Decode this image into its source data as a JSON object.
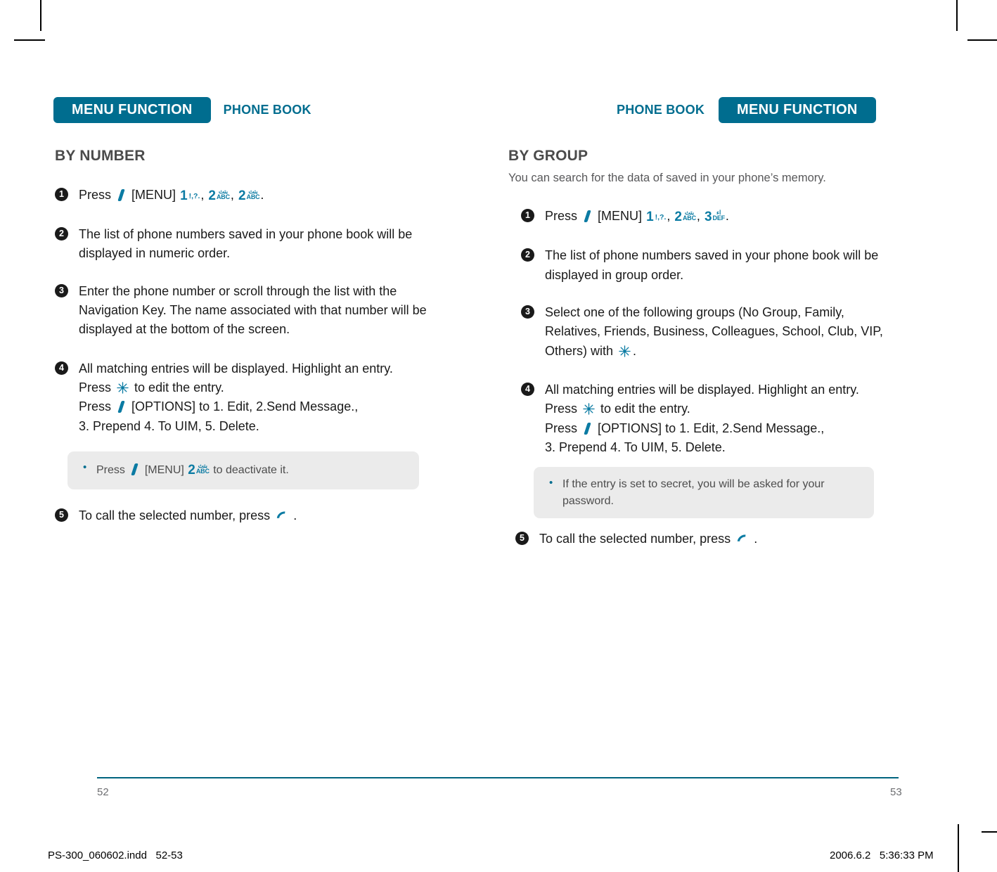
{
  "document": {
    "title": "Phone Book — Menu Function (pages 52-53)"
  },
  "left_page": {
    "header": {
      "tab_label": "MENU FUNCTION",
      "section_label": "PHONE BOOK"
    },
    "section_title": "BY NUMBER",
    "steps": [
      {
        "num": "1",
        "prefix": "Press",
        "menu_label": "[MENU]",
        "keys": [
          "1",
          "2",
          "2"
        ],
        "suffix": "."
      },
      {
        "num": "2",
        "text": "The list of phone numbers saved in your phone book will be displayed in numeric order."
      },
      {
        "num": "3",
        "text": "Enter the phone number or scroll through the list with the Navigation Key. The name associated with that number will be displayed at the bottom of the screen."
      },
      {
        "num": "4",
        "line1": "All matching entries will be displayed. Highlight an entry. Press",
        "line1_tail": "to edit the entry.",
        "line2_prefix": "Press",
        "line2_label": "[OPTIONS]",
        "line2_tail": "to 1. Edit, 2.Send Message.,",
        "line3": "3. Prepend 4. To UIM, 5. Delete."
      },
      {
        "num": "5",
        "text": "To call the selected number, press",
        "tail": "."
      }
    ],
    "note": {
      "bullet": "•",
      "prefix": "Press",
      "menu_label": "[MENU]",
      "key": "2",
      "tail": "to deactivate it."
    },
    "folio": "52"
  },
  "right_page": {
    "header": {
      "section_label": "PHONE BOOK",
      "tab_label": "MENU FUNCTION"
    },
    "section_title": "BY GROUP",
    "section_subtitle": "You can search for the data of saved in your phone’s memory.",
    "steps": [
      {
        "num": "1",
        "prefix": "Press",
        "menu_label": "[MENU]",
        "keys": [
          "1",
          "2",
          "3"
        ],
        "suffix": "."
      },
      {
        "num": "2",
        "text": "The list of phone numbers saved in your phone book will be displayed in group order."
      },
      {
        "num": "3",
        "text": "Select one of the following groups (No Group, Family, Relatives, Friends, Business, Colleagues, School, Club, VIP, Others) with",
        "tail": "."
      },
      {
        "num": "4",
        "line1": "All matching entries will be displayed. Highlight an entry. Press",
        "line1_tail": "to edit the entry.",
        "line2_prefix": "Press",
        "line2_label": "[OPTIONS]",
        "line2_tail": "to 1. Edit, 2.Send Message.,",
        "line3": "3. Prepend 4. To UIM, 5. Delete."
      },
      {
        "num": "5",
        "text": "To call the selected number, press",
        "tail": "."
      }
    ],
    "note": {
      "bullet": "•",
      "text": "If the entry is set to secret, you will be asked for your password."
    },
    "folio": "53"
  },
  "keypad": {
    "key1": {
      "digit": "1",
      "sub": "!,?."
    },
    "key2": {
      "digit": "2",
      "arabic": "بتث",
      "latin": "ABC"
    },
    "key3": {
      "digit": "3",
      "arabic": "اء",
      "latin": "DEF"
    }
  },
  "print_slug": {
    "filename": "PS-300_060602.indd",
    "pages": "52-53",
    "date": "2006.6.2",
    "time": "5:36:33 PM"
  },
  "colors": {
    "brand_teal": "#006d8f",
    "key_teal": "#0b7ba3",
    "note_bg": "#ebebeb",
    "folio_gray": "#6d6e71",
    "title_gray": "#4b4b4b"
  }
}
